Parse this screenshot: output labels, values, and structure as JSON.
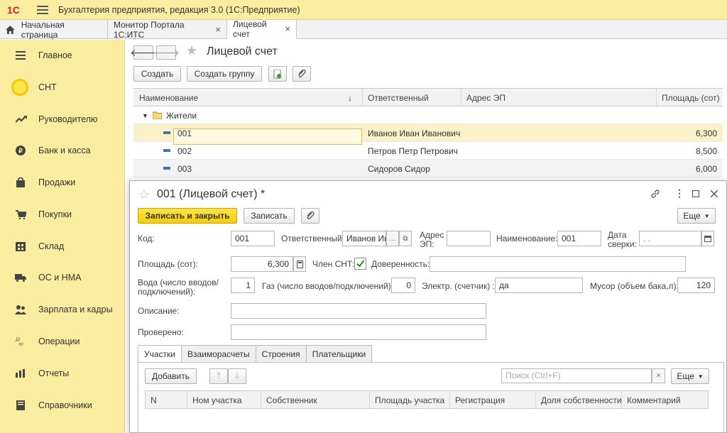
{
  "app": {
    "logo": "1С",
    "title": "Бухгалтерия предприятия, редакция 3.0  (1С:Предприятие)"
  },
  "tabs": [
    {
      "label": "Начальная страница"
    },
    {
      "label": "Монитор Портала 1С:ИТС",
      "close": "×"
    },
    {
      "label": "Лицевой счет",
      "close": "×"
    }
  ],
  "sidebar": {
    "items": [
      {
        "label": "Главное",
        "icon": "menu-icon"
      },
      {
        "label": "СНТ",
        "icon": "snt-circle-icon"
      },
      {
        "label": "Руководителю",
        "icon": "trend-icon"
      },
      {
        "label": "Банк и касса",
        "icon": "coin-icon"
      },
      {
        "label": "Продажи",
        "icon": "bag-icon"
      },
      {
        "label": "Покупки",
        "icon": "cart-icon"
      },
      {
        "label": "Склад",
        "icon": "warehouse-icon"
      },
      {
        "label": "ОС и НМА",
        "icon": "truck-icon"
      },
      {
        "label": "Зарплата и кадры",
        "icon": "people-icon"
      },
      {
        "label": "Операции",
        "icon": "dt-kt-icon"
      },
      {
        "label": "Отчеты",
        "icon": "report-icon"
      },
      {
        "label": "Справочники",
        "icon": "book-icon"
      }
    ]
  },
  "list": {
    "title": "Лицевой счет",
    "create": "Создать",
    "create_group": "Создать группу",
    "columns": [
      "Наименование",
      "Ответственный",
      "Адрес ЭП",
      "Площадь (сот)"
    ],
    "sort_icon": "↓",
    "group": "Жители",
    "rows": [
      {
        "name": "001",
        "resp": "Иванов Иван Иванович",
        "email": "",
        "area": "6,300"
      },
      {
        "name": "002",
        "resp": "Петров Петр Петрович",
        "email": "",
        "area": "8,500"
      },
      {
        "name": "003",
        "resp": "Сидоров Сидор",
        "email": "",
        "area": "6,000"
      }
    ]
  },
  "form": {
    "title": "001 (Лицевой счет) *",
    "save_close": "Записать и закрыть",
    "save": "Записать",
    "more": "Еще",
    "code_label": "Код:",
    "code": "001",
    "resp_label": "Ответственный:",
    "resp": "Иванов Ив",
    "email_label": "Адрес ЭП:",
    "email": "",
    "name_label": "Наименование:",
    "name": "001",
    "date_label": "Дата сверки:",
    "date": " .  .",
    "area_label": "Площадь (сот):",
    "area": "6,300",
    "member_label": "Член СНТ:",
    "member_checked": true,
    "trust_label": "Доверенность:",
    "trust": "",
    "water_label": "Вода (число вводов/подключений):",
    "water": "1",
    "gas_label": "Газ (число вводов/подключений):",
    "gas": "0",
    "electric_label": "Электр. (счетчик) :",
    "electric": "да",
    "trash_label": "Мусор (объем бака,л):",
    "trash": "120",
    "desc_label": "Описание:",
    "desc": "",
    "checked_label": "Проверено:",
    "checked": "",
    "tabs": [
      "Участки",
      "Взаиморасчеты",
      "Строения",
      "Плательщики"
    ],
    "add": "Добавить",
    "search_placeholder": "Поиск (Ctrl+F)",
    "search_clear": "×",
    "more2": "Еще",
    "columns": [
      "N",
      "Ном участка",
      "Собственник",
      "Площадь участка",
      "Регистрация",
      "Доля собственности",
      "Комментарий"
    ]
  }
}
